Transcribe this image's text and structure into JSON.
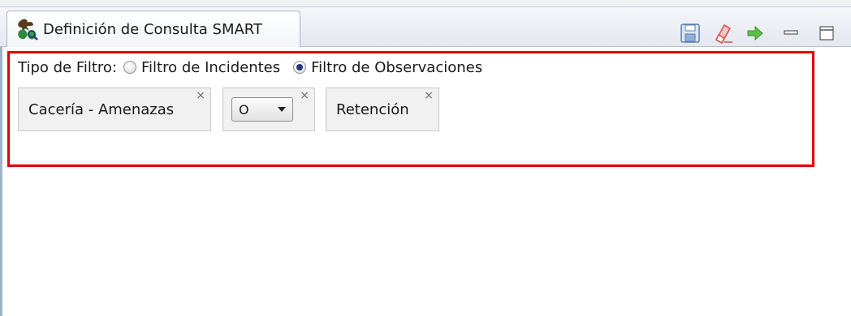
{
  "tab": {
    "label": "Definición de Consulta SMART",
    "icon": "smart-query-icon"
  },
  "toolbar": {
    "icons": [
      "save-icon",
      "eraser-icon",
      "run-arrow-icon",
      "minimize-icon",
      "maximize-icon"
    ],
    "colors": {
      "eraser": "#d9534f",
      "run": "#3fa34d",
      "save": "#5a7fb0"
    }
  },
  "filter": {
    "label": "Tipo de Filtro:",
    "options": [
      {
        "label": "Filtro de Incidentes",
        "selected": false
      },
      {
        "label": "Filtro de Observaciones",
        "selected": true
      }
    ]
  },
  "chips": [
    {
      "text": "Cacería - Amenazas",
      "close": "×"
    },
    {
      "select_value": "O",
      "close": "×"
    },
    {
      "text": "Retención",
      "close": "×"
    }
  ],
  "highlight_color": "#e60000"
}
